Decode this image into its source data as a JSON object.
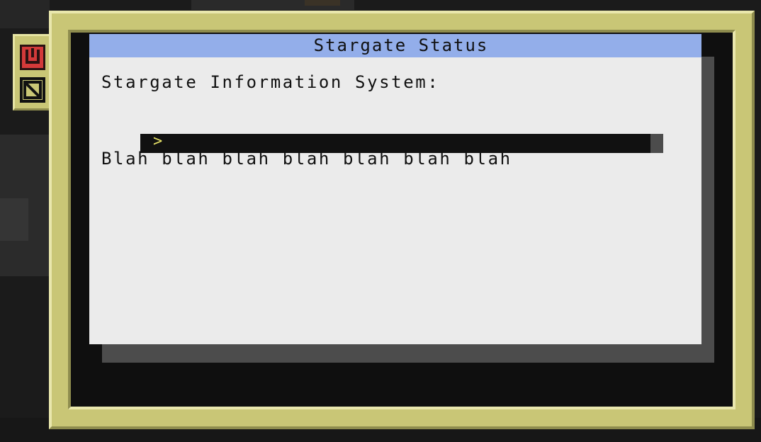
{
  "window": {
    "title": "Stargate Status"
  },
  "screen": {
    "heading": "Stargate Information System:",
    "prompt_symbol": ">",
    "body_text": "Blah blah blah blah blah blah blah"
  },
  "side_tabs": {
    "power_icon": "power-icon",
    "disable_icon": "disable-icon"
  },
  "colors": {
    "frame": "#c9c676",
    "title_bar": "#93aeea",
    "screen_bg": "#ebebeb",
    "prompt": "#e3df66",
    "power_button": "#d33a3a"
  }
}
